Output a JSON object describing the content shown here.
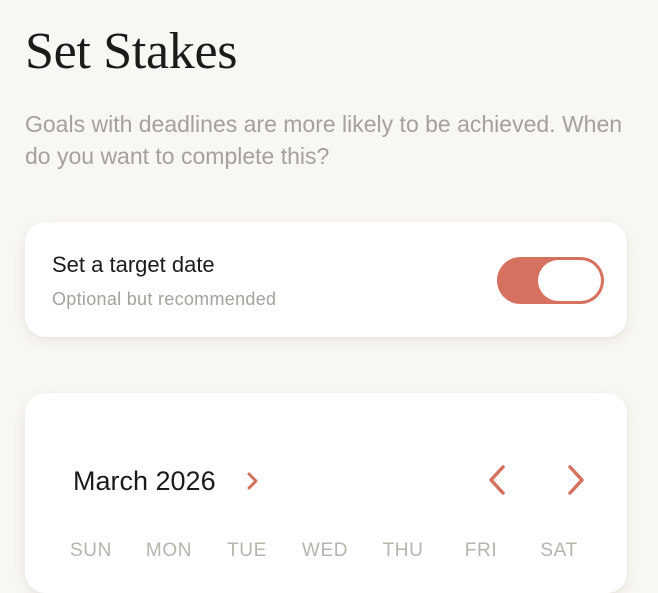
{
  "header": {
    "title": "Set Stakes",
    "subtitle": "Goals with deadlines are more likely to be achieved. When do you want to complete this?"
  },
  "target_date": {
    "title": "Set a target date",
    "subtitle": "Optional but recommended",
    "enabled": true
  },
  "calendar": {
    "month_label": "March 2026",
    "weekdays": [
      "SUN",
      "MON",
      "TUE",
      "WED",
      "THU",
      "FRI",
      "SAT"
    ]
  },
  "colors": {
    "accent": "#d6715f",
    "background": "#f9f7f3",
    "text": "#1c1b19",
    "muted": "#a5a19b"
  },
  "icons": {
    "month_picker": "chevron-right-icon",
    "prev_month": "chevron-left-icon",
    "next_month": "chevron-right-icon"
  }
}
